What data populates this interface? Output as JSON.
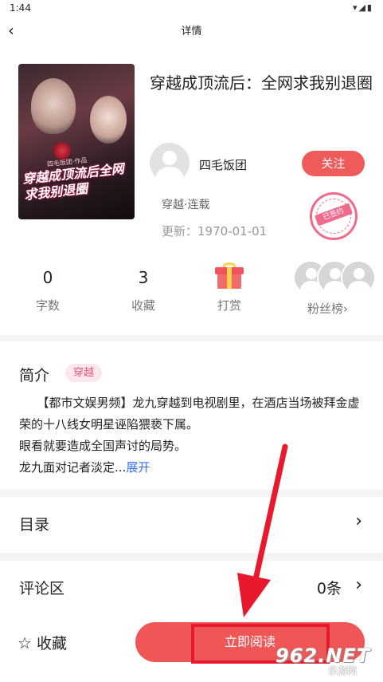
{
  "status_bar": {
    "time": "1:44",
    "icons": "▾◢▮"
  },
  "navbar": {
    "back_icon": "‹",
    "title": "详情"
  },
  "book": {
    "cover_title": "穿越成顶流后全网求我别退圈",
    "cover_author": "四毛饭团·作品",
    "title": "穿越成顶流后：全网求我别退圈",
    "author": "四毛饭团",
    "follow_label": "关注",
    "genre_status": "穿越·连载",
    "update_label": "更新：",
    "update_date": "1970-01-01",
    "stamp_text": "已签约"
  },
  "stats": [
    {
      "value": "0",
      "label": "字数"
    },
    {
      "value": "3",
      "label": "收藏"
    },
    {
      "value": "",
      "label": "打赏"
    },
    {
      "value": "",
      "label": "粉丝榜›"
    }
  ],
  "intro": {
    "title": "简介",
    "tag": "穿越",
    "lines": [
      "　　【都市文娱男频】龙九穿越到电视剧里，在酒店当场被拜金虚荣的十八线女明星诬陷猥亵下属。",
      "眼看就要造成全国声讨的局势。",
      "龙九面对记者淡定..."
    ],
    "expand_label": "展开"
  },
  "catalog_row": {
    "label": "目录",
    "arrow": "›"
  },
  "comment_row": {
    "label": "评论区",
    "value": "0条",
    "arrow": "›"
  },
  "bottom_bar": {
    "star_icon": "☆",
    "fav_label": "收藏",
    "read_label": "立即阅读"
  },
  "watermark": {
    "number": "962.NET",
    "sub": "乐游网"
  },
  "colors": {
    "accent": "#ef5656",
    "tag_bg": "#fde7ec",
    "tag_text": "#e4587a",
    "link": "#3b6fe0",
    "annotation": "#e8192c"
  }
}
